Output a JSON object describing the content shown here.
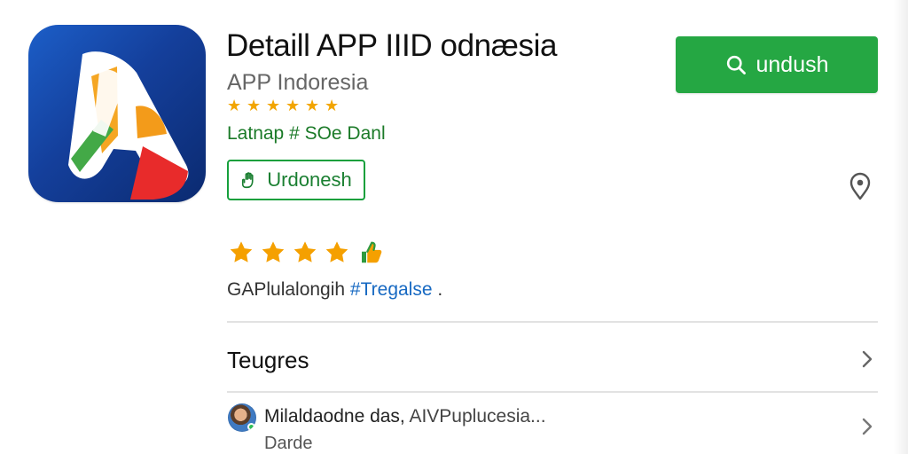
{
  "app": {
    "title": "Detaill APP IIID odnæsia",
    "developer": "APP Indoresia",
    "small_rating_stars": [
      "★",
      "★",
      "★",
      "★",
      "★",
      "★"
    ],
    "category": "Latnap # SOe Danl",
    "tag_label": "Urdonesh",
    "download_label": "undush"
  },
  "rating": {
    "stars": 4,
    "line_prefix": "GAPlulalongih ",
    "line_link": "#Tregalse",
    "line_suffix": " ."
  },
  "sections": [
    {
      "title": "Teugres"
    }
  ],
  "review": {
    "text_main": "Milaldaodne das, ",
    "text_soft": "AIVPuplucesia...",
    "subtext": "Darde"
  },
  "icons": {
    "app": "app-logo-icon",
    "download": "search-icon",
    "tag": "hand-icon",
    "location": "location-pin-icon",
    "thumb": "thumbs-up-icon",
    "chevron": "chevron-right-icon",
    "star": "star-icon"
  },
  "colors": {
    "brand_blue": "#143f9b",
    "brand_green": "#25a743",
    "star_orange": "#f2a500",
    "link_blue": "#1769c2"
  }
}
